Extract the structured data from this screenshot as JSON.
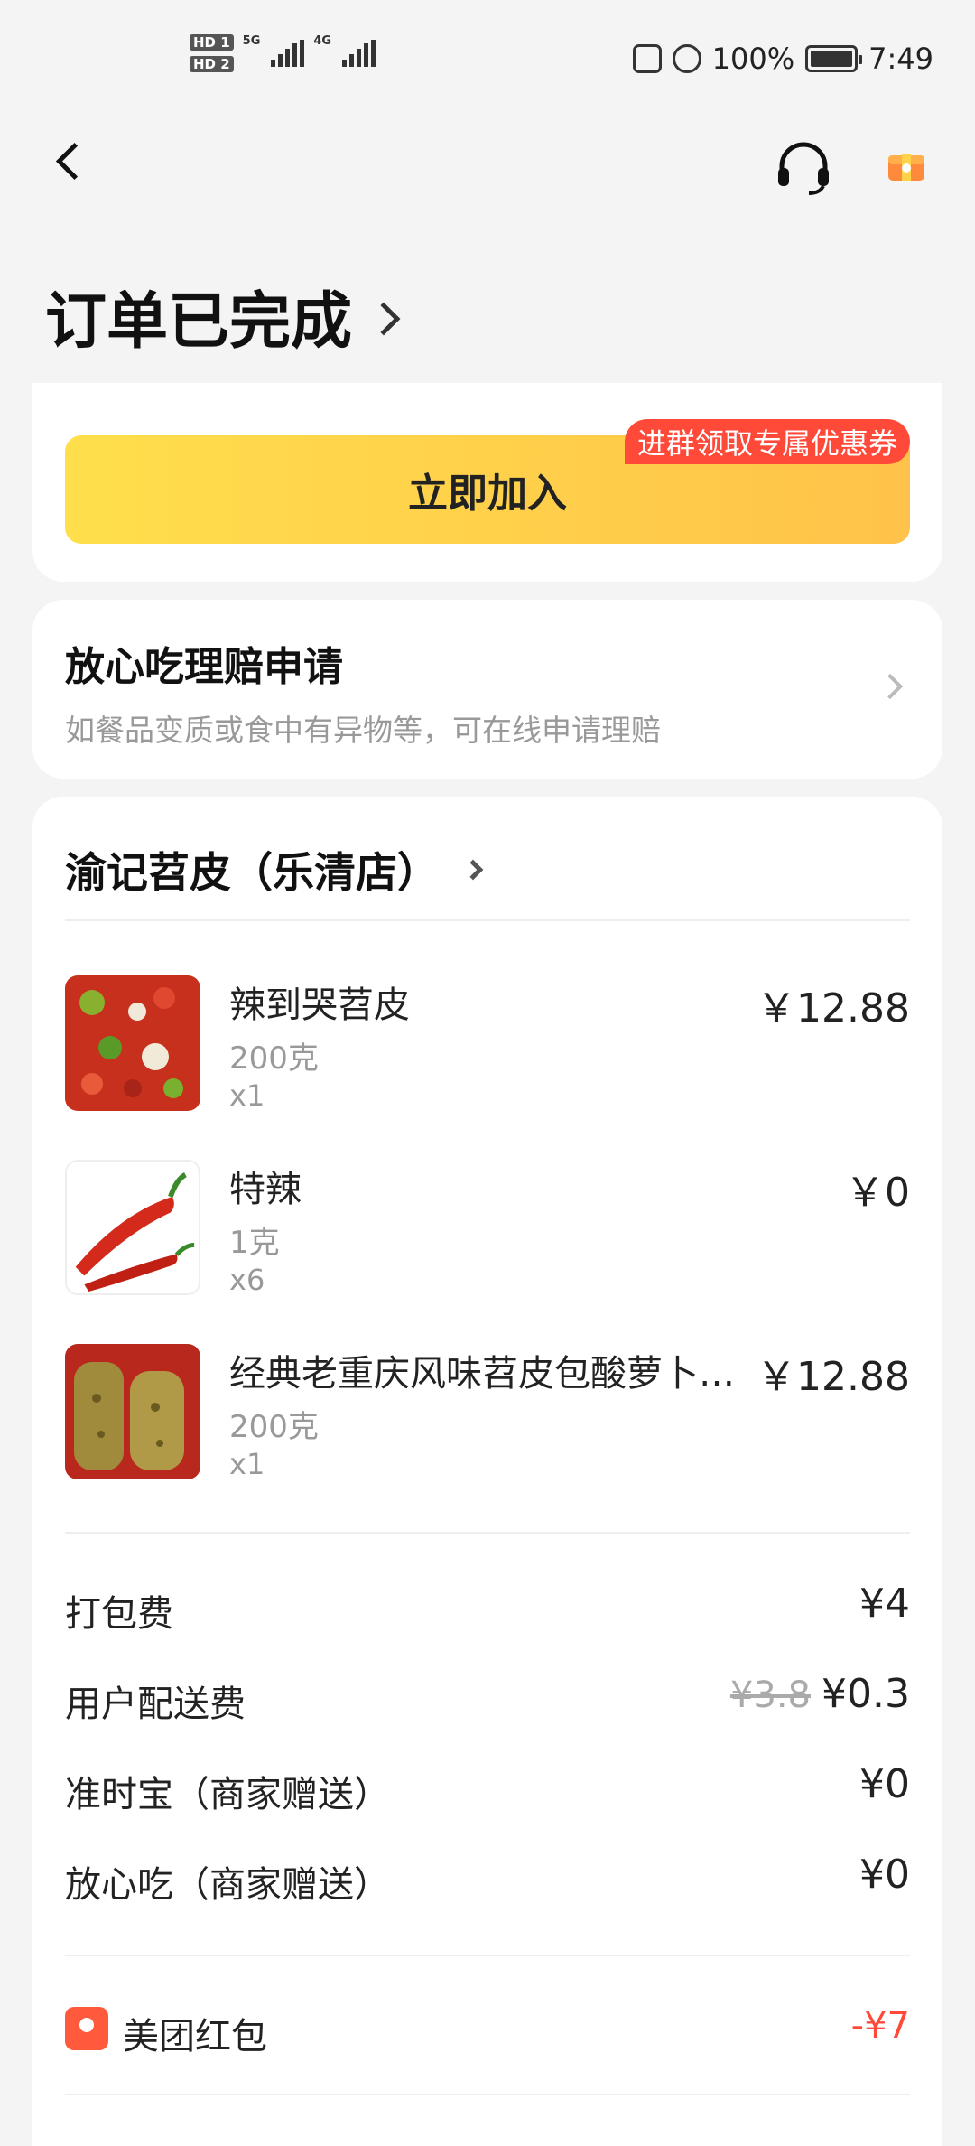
{
  "status_bar": {
    "hd1": "HD 1",
    "hd2": "HD 2",
    "net1": "5G",
    "net2": "4G",
    "battery": "100%",
    "time": "7:49"
  },
  "header": {
    "title": "订单已完成"
  },
  "join_card": {
    "button_label": "立即加入",
    "promo_tag": "进群领取专属优惠券"
  },
  "claim_card": {
    "title": "放心吃理赔申请",
    "subtitle": "如餐品变质或食中有异物等，可在线申请理赔"
  },
  "order": {
    "shop_name": "渝记苕皮（乐清店）",
    "items": [
      {
        "name": "辣到哭苕皮",
        "spec": "200克",
        "qty": "x1",
        "price": "￥12.88"
      },
      {
        "name": "特辣",
        "spec": "1克",
        "qty": "x6",
        "price": "￥0"
      },
      {
        "name": "经典老重庆风味苕皮包酸萝卜…",
        "spec": "200克",
        "qty": "x1",
        "price": "￥12.88"
      }
    ],
    "fees": [
      {
        "label": "打包费",
        "value": "¥4",
        "original": ""
      },
      {
        "label": "用户配送费",
        "value": "¥0.3",
        "original": "¥3.8"
      },
      {
        "label": "准时宝（商家赠送）",
        "value": "¥0",
        "original": ""
      },
      {
        "label": "放心吃（商家赠送）",
        "value": "¥0",
        "original": ""
      }
    ],
    "red_packet": {
      "label": "美团红包",
      "value": "-¥7"
    }
  },
  "colors": {
    "accent_yellow": "#ffd24a",
    "promo_red": "#ff4a3a",
    "background": "#f4f4f4"
  }
}
